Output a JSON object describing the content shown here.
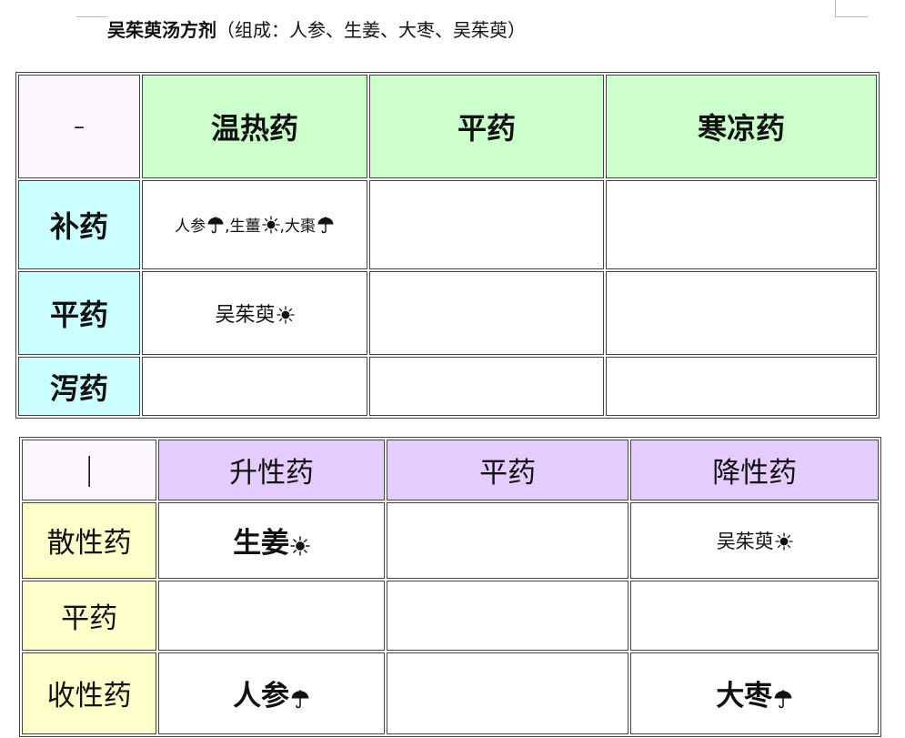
{
  "title": {
    "bold": "吴茱萸汤方剂",
    "rest": "（组成：人参、生姜、大枣、吴茱萸）"
  },
  "table1": {
    "corner": "–",
    "headers": [
      "温热药",
      "平药",
      "寒凉药"
    ],
    "rows": [
      {
        "label": "补药",
        "cells": [
          [
            {
              "text": "人参",
              "icon": "umbrella-icon"
            },
            {
              "text": ",生薑",
              "icon": "sun-icon"
            },
            {
              "text": ",大棗",
              "icon": "umbrella-icon"
            }
          ],
          [],
          []
        ]
      },
      {
        "label": "平药",
        "cells": [
          [
            {
              "text": "吴茱萸",
              "icon": "sun-icon"
            }
          ],
          [],
          []
        ]
      },
      {
        "label": "泻药",
        "cells": [
          [],
          [],
          []
        ]
      }
    ]
  },
  "table2": {
    "corner": "|",
    "headers": [
      "升性药",
      "平药",
      "降性药"
    ],
    "rows": [
      {
        "label": "散性药",
        "cells": [
          [
            {
              "text": "生姜",
              "icon": "sun-icon"
            }
          ],
          [],
          [
            {
              "text": "吴茱萸",
              "icon": "sun-icon"
            }
          ]
        ]
      },
      {
        "label": "平药",
        "cells": [
          [],
          [],
          []
        ]
      },
      {
        "label": "收性药",
        "cells": [
          [
            {
              "text": "人参",
              "icon": "umbrella-icon"
            }
          ],
          [],
          [
            {
              "text": "大枣",
              "icon": "umbrella-icon"
            }
          ]
        ]
      }
    ]
  }
}
